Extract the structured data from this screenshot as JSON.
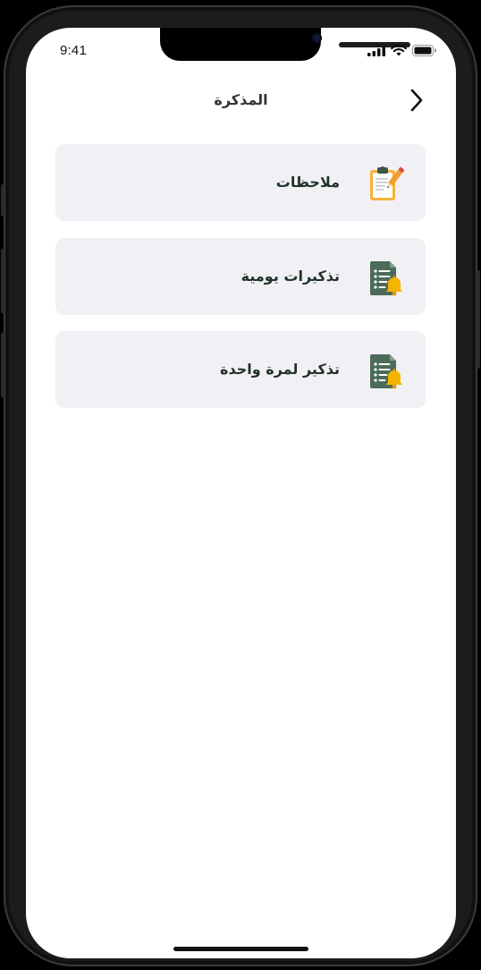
{
  "status_bar": {
    "time": "9:41",
    "icons": [
      "cellular-signal-icon",
      "wifi-icon",
      "battery-icon"
    ]
  },
  "header": {
    "title": "المذكرة",
    "back_icon": "chevron-right-icon"
  },
  "menu": {
    "items": [
      {
        "label": "ملاحظات",
        "icon": "notes-clipboard-icon"
      },
      {
        "label": "تذكيرات يومية",
        "icon": "checklist-bell-icon"
      },
      {
        "label": "تذكير لمرة واحدة",
        "icon": "checklist-bell-icon"
      }
    ]
  },
  "colors": {
    "card_background": "#f1f0f5",
    "label_text": "#1e3327",
    "icon_green": "#4c6b5a",
    "bell_yellow": "#f4b400"
  }
}
